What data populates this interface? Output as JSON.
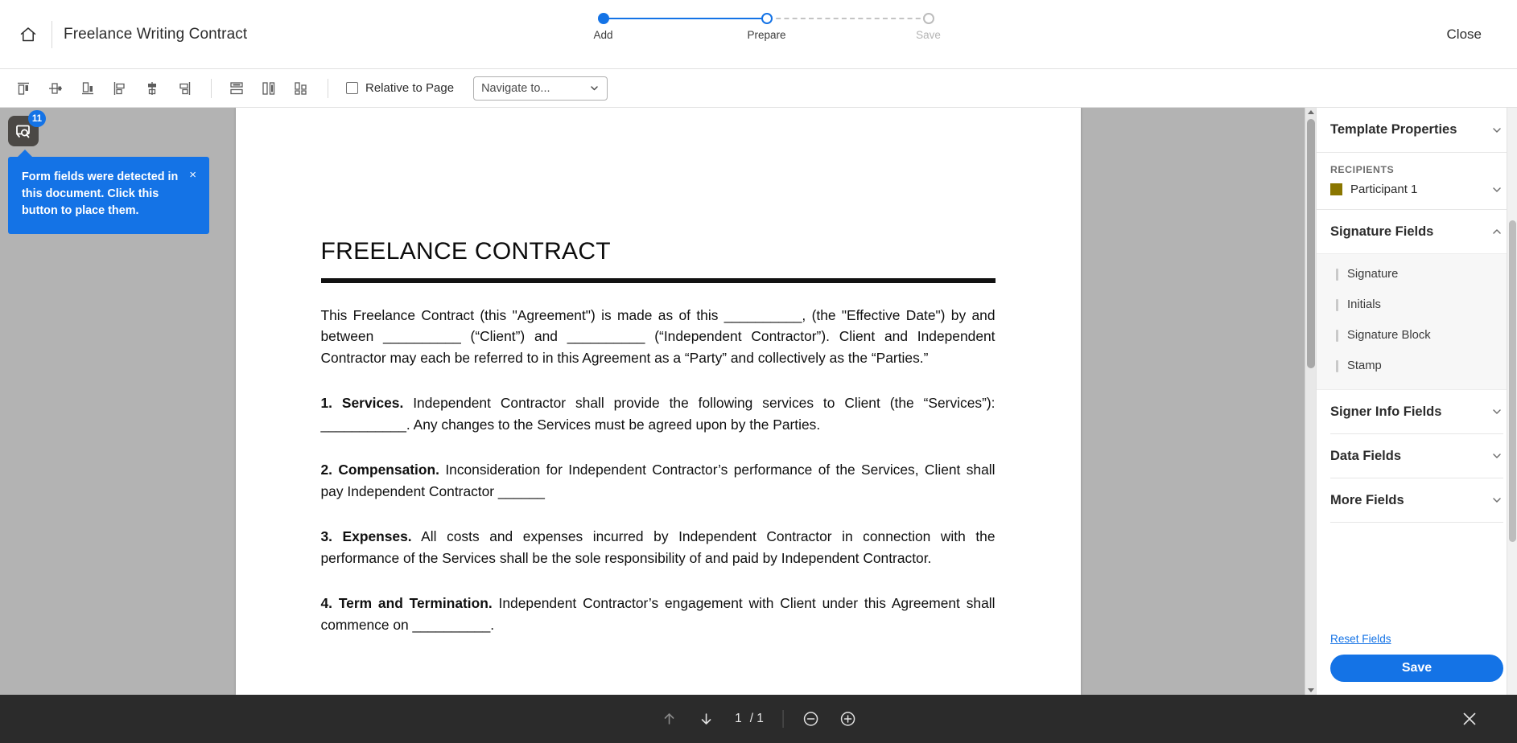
{
  "header": {
    "home_icon": "home-icon",
    "document_title": "Freelance Writing Contract",
    "close_label": "Close",
    "steps": [
      {
        "label": "Add",
        "state": "done"
      },
      {
        "label": "Prepare",
        "state": "current"
      },
      {
        "label": "Save",
        "state": "todo"
      }
    ]
  },
  "toolbar": {
    "align_tools": [
      "align-top-icon",
      "align-middle-horizontal-icon",
      "align-bottom-icon",
      "align-left-icon",
      "align-center-icon",
      "align-right-icon"
    ],
    "distribute_tools": [
      "distribute-vertical-icon",
      "distribute-horizontal-icon",
      "match-size-icon"
    ],
    "relative_to_page": {
      "label": "Relative to Page",
      "checked": false
    },
    "navigate_select": {
      "value": "Navigate to...",
      "options": [
        "Navigate to..."
      ]
    }
  },
  "detect": {
    "badge_count": "11",
    "icon": "detect-form-fields-icon",
    "tooltip_text": "Form fields were detected in this document. Click this button to place them.",
    "tooltip_close": "×"
  },
  "document": {
    "title": "FREELANCE CONTRACT",
    "paragraphs": [
      {
        "type": "plain",
        "text": "This Freelance Contract (this  \"Agreement\") is made as of this __________, (the \"Effective Date\") by and between __________ (“Client”) and __________ (“Independent Contractor”). Client and Independent Contractor may each be referred to in this Agreement as a “Party” and collectively as the “Parties.”"
      },
      {
        "type": "numbered",
        "heading": "1.   Services.",
        "text": " Independent Contractor shall provide the following services to Client (the “Services”): ___________. Any changes to the Services must be agreed upon by the Parties."
      },
      {
        "type": "numbered",
        "heading": "2. Compensation.",
        "text": " Inconsideration for Independent Contractor’s performance of the Services, Client shall pay Independent Contractor  ______"
      },
      {
        "type": "numbered",
        "heading": "3. Expenses.",
        "text": " All costs and expenses incurred by Independent Contractor in connection with the performance of the Services shall be the sole responsibility of and paid by Independent Contractor."
      },
      {
        "type": "numbered",
        "heading": "4. Term and Termination.",
        "text": " Independent Contractor’s engagement with Client under this Agreement shall commence on __________."
      }
    ]
  },
  "right_panel": {
    "title": "Template Properties",
    "recipients": {
      "label": "RECIPIENTS",
      "participant": "Participant 1",
      "swatch_color": "#8a7600"
    },
    "sections": [
      {
        "title": "Signature Fields",
        "expanded": true,
        "items": [
          "Signature",
          "Initials",
          "Signature Block",
          "Stamp"
        ]
      },
      {
        "title": "Signer Info Fields",
        "expanded": false,
        "items": []
      },
      {
        "title": "Data Fields",
        "expanded": false,
        "items": []
      },
      {
        "title": "More Fields",
        "expanded": false,
        "items": []
      }
    ],
    "reset_link": "Reset Fields",
    "save_label": "Save",
    "accent_color": "#1473e6"
  },
  "bottom_bar": {
    "prev_page_icon": "arrow-up-icon",
    "next_page_icon": "arrow-down-icon",
    "current_page": "1",
    "page_separator": "/ 1",
    "zoom_out_icon": "zoom-out-icon",
    "zoom_in_icon": "zoom-in-icon",
    "close_icon": "close-icon"
  }
}
